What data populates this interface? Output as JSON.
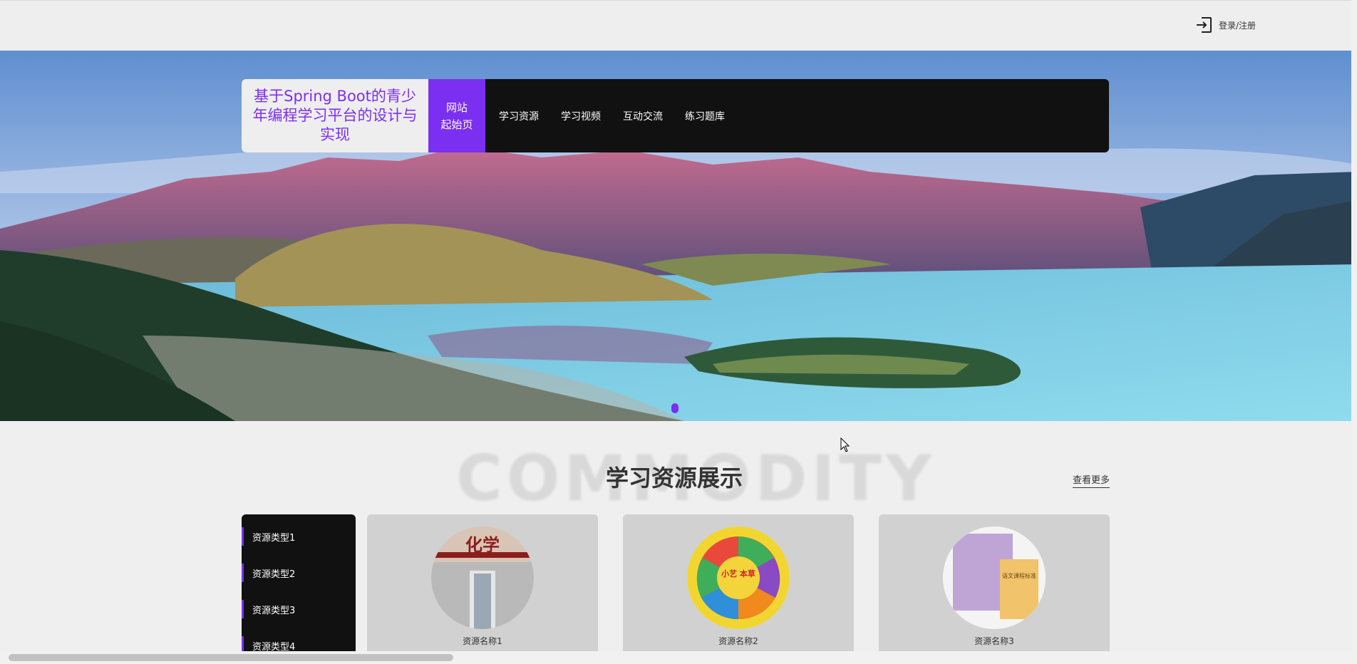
{
  "header": {
    "login_label": "登录/注册"
  },
  "nav": {
    "brand": "基于Spring Boot的青少年编程学习平台的设计与实现",
    "home_line1": "网站",
    "home_line2": "起始页",
    "items": [
      "学习资源",
      "学习视频",
      "互动交流",
      "练习题库"
    ]
  },
  "section": {
    "watermark": "COMMODITY",
    "title": "学习资源展示",
    "more_label": "查看更多"
  },
  "categories": [
    "资源类型1",
    "资源类型2",
    "资源类型3",
    "资源类型4"
  ],
  "cards": [
    {
      "name": "资源名称1",
      "thumb_text": "化学"
    },
    {
      "name": "资源名称2",
      "thumb_text": "小艺 本草"
    },
    {
      "name": "资源名称3",
      "thumb_text": "语文课程标准"
    }
  ],
  "colors": {
    "accent": "#7b2ff0",
    "nav_bg": "#111111",
    "page_bg": "#efefef"
  }
}
